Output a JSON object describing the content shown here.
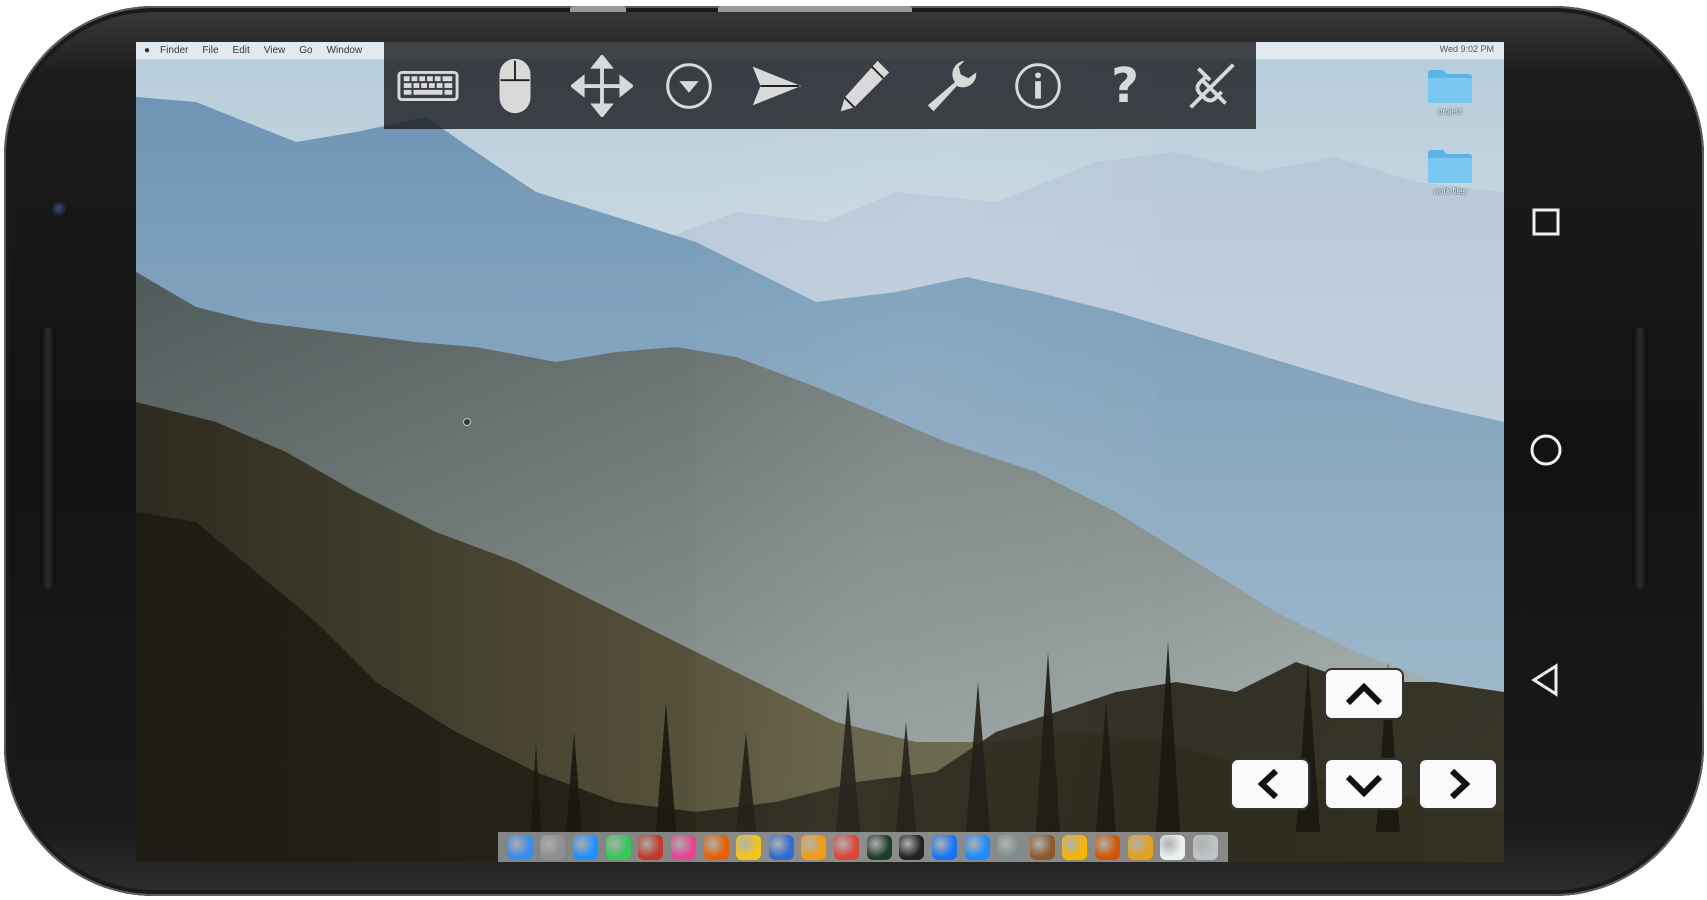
{
  "device": {
    "type": "android-phone-landscape"
  },
  "desktop": {
    "menubar": {
      "apple_icon": "apple-logo-icon",
      "menus": [
        "Finder",
        "File",
        "Edit",
        "View",
        "Go",
        "Window"
      ],
      "clock": "Wed 9:02 PM"
    },
    "folders": [
      {
        "icon": "folder-icon",
        "label": "project"
      },
      {
        "icon": "folder-icon",
        "label": "work files"
      }
    ],
    "dock": {
      "apps": [
        {
          "name": "finder",
          "color": "#3a8bea"
        },
        {
          "name": "launchpad",
          "color": "#8e8e93"
        },
        {
          "name": "safari",
          "color": "#1e90ff"
        },
        {
          "name": "messages",
          "color": "#34c759"
        },
        {
          "name": "photo-booth",
          "color": "#c0392b"
        },
        {
          "name": "itunes",
          "color": "#e84393"
        },
        {
          "name": "firefox",
          "color": "#e66000"
        },
        {
          "name": "app-yellow",
          "color": "#f5c518"
        },
        {
          "name": "thunderbird",
          "color": "#2f6bd3"
        },
        {
          "name": "ibooks",
          "color": "#f39c12"
        },
        {
          "name": "chrome",
          "color": "#db4437"
        },
        {
          "name": "activity-monitor",
          "color": "#1f3b2c"
        },
        {
          "name": "terminal",
          "color": "#222222"
        },
        {
          "name": "xcode",
          "color": "#1575f9"
        },
        {
          "name": "app-store",
          "color": "#1a8cff"
        },
        {
          "name": "preview",
          "color": "#7f8c8d"
        },
        {
          "name": "app-brown",
          "color": "#8e5a2b"
        },
        {
          "name": "sketch",
          "color": "#f7b500"
        },
        {
          "name": "app-multicolor",
          "color": "#d35400"
        },
        {
          "name": "folder-stack",
          "color": "#e4a11b"
        },
        {
          "name": "documents",
          "color": "#ecf0f1"
        },
        {
          "name": "trash",
          "color": "#bdc3c7"
        }
      ]
    }
  },
  "toolbar": {
    "buttons": [
      {
        "icon": "keyboard-icon",
        "name": "keyboard-button"
      },
      {
        "icon": "mouse-icon",
        "name": "mouse-button"
      },
      {
        "icon": "move-arrows-icon",
        "name": "pan-button"
      },
      {
        "icon": "dropdown-circle-icon",
        "name": "menu-button"
      },
      {
        "icon": "send-icon",
        "name": "send-button"
      },
      {
        "icon": "pencil-icon",
        "name": "draw-button"
      },
      {
        "icon": "wrench-icon",
        "name": "settings-button"
      },
      {
        "icon": "info-icon",
        "name": "info-button"
      },
      {
        "icon": "question-icon",
        "name": "help-button"
      },
      {
        "icon": "disconnect-icon",
        "name": "disconnect-button"
      }
    ],
    "help_glyph": "?"
  },
  "arrow_keys": {
    "up": "chevron-up-icon",
    "left": "chevron-left-icon",
    "down": "chevron-down-icon",
    "right": "chevron-right-icon"
  },
  "android_nav": {
    "recents": "square-icon",
    "home": "circle-icon",
    "back": "triangle-back-icon"
  },
  "colors": {
    "toolbar_bg": "#1c1e22",
    "toolbar_icon": "#d9d9d9",
    "folder": "#5ab4e8"
  }
}
